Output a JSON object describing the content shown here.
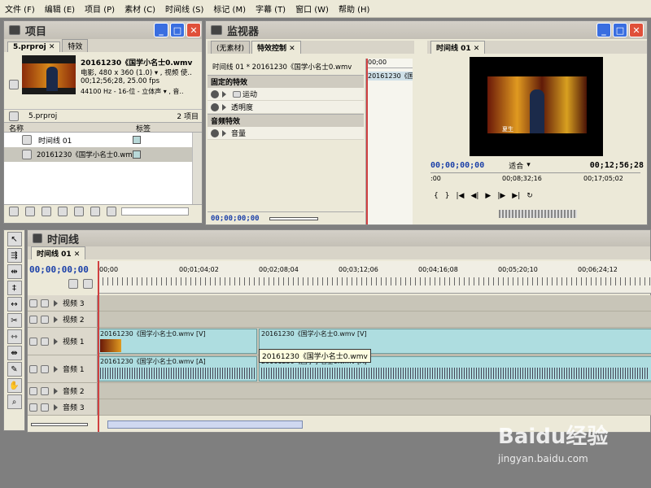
{
  "menu": [
    "文件 (F)",
    "编辑 (E)",
    "项目 (P)",
    "素材 (C)",
    "时间线 (S)",
    "标记 (M)",
    "字幕 (T)",
    "窗口 (W)",
    "帮助 (H)"
  ],
  "project": {
    "title": "项目",
    "tabs": [
      "5.prproj",
      "特效"
    ],
    "clip_name": "20161230《国学小名士0.wmv",
    "clip_info1": "电影, 480 x 360 (1.0) ▾ , 视频 使..",
    "clip_info2": "00;12;56;28, 25.00 fps",
    "clip_info3": "44100 Hz - 16-位 - 立体声 ▾ , 音..",
    "file_name": "5.prproj",
    "item_count": "2 项目",
    "col_name": "名称",
    "col_label": "标签",
    "items": [
      {
        "name": "时间线 01",
        "icon": "sequence-icon"
      },
      {
        "name": "20161230《国学小名士0.wmv",
        "icon": "video-clip-icon"
      }
    ]
  },
  "monitor": {
    "title": "监视器",
    "tabs": [
      "(无素材)",
      "特效控制"
    ],
    "header": "时间线 01 * 20161230《国学小名士0.wmv",
    "timecode_top": "00;00",
    "clip_tag": "20161230《国",
    "section_fixed": "固定的特效",
    "effects": [
      "运动",
      "透明度"
    ],
    "section_audio": "音频特效",
    "audio_effects": [
      "音量"
    ],
    "bottom_tc": "00;00;00;00"
  },
  "program": {
    "tab": "时间线 01",
    "tc_current": "00;00;00;00",
    "fit": "适合",
    "tc_duration": "00;12;56;28",
    "ruler_mid": "00;08;32;16",
    "ruler_right": "00;17;05;02",
    "video_caption": "夏生"
  },
  "timeline": {
    "title": "时间线",
    "tab": "时间线 01",
    "tc": "00;00;00;00",
    "ruler": [
      "00;00",
      "00;01;04;02",
      "00;02;08;04",
      "00;03;12;06",
      "00;04;16;08",
      "00;05;20;10",
      "00;06;24;12"
    ],
    "tracks": [
      "视频 3",
      "视频 2",
      "视频 1",
      "音频 1",
      "音频 2",
      "音频 3"
    ],
    "clip_v1a": "20161230《国学小名士0.wmv [V]",
    "clip_v1b": "20161230《国学小名士0.wmv [V]",
    "clip_a1a": "20161230《国学小名士0.wmv [A]",
    "clip_a1b": "20161230《国学小名士0.wmv [A]",
    "tooltip": "20161230《国学小名士0.wmv"
  },
  "watermark": {
    "brand": "Baidu经验",
    "url": "jingyan.baidu.com"
  }
}
